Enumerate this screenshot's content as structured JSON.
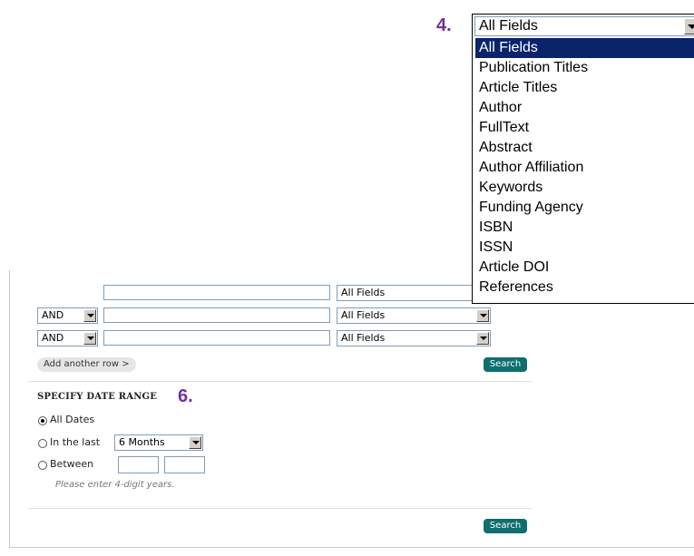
{
  "callouts": {
    "step4": "4.",
    "step6": "6."
  },
  "dropdown": {
    "selected": "All Fields",
    "options": [
      "All Fields",
      "Publication Titles",
      "Article Titles",
      "Author",
      "FullText",
      "Abstract",
      "Author Affiliation",
      "Keywords",
      "Funding Agency",
      "ISBN",
      "ISSN",
      "Article DOI",
      "References"
    ]
  },
  "search_rows": [
    {
      "operator": "",
      "term": "",
      "field": "All Fields"
    },
    {
      "operator": "AND",
      "term": "",
      "field": "All Fields"
    },
    {
      "operator": "AND",
      "term": "",
      "field": "All Fields"
    }
  ],
  "add_row_label": "Add another row >",
  "search_label": "Search",
  "date_range": {
    "heading": "SPECIFY DATE RANGE",
    "all_dates": "All Dates",
    "in_the_last": "In the last",
    "period": "6 Months",
    "between": "Between",
    "from_year": "",
    "to_year": "",
    "hint": "Please enter 4-digit years."
  },
  "colors": {
    "accent": "#0f6e70",
    "callout": "#7030a0",
    "highlight": "#0a246a"
  }
}
